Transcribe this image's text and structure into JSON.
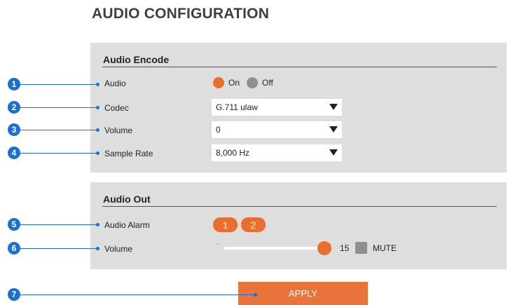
{
  "page": {
    "title": "AUDIO CONFIGURATION"
  },
  "audio_encode": {
    "title": "Audio Encode",
    "audio": {
      "label": "Audio",
      "options": [
        "On",
        "Off"
      ],
      "selected": "On"
    },
    "codec": {
      "label": "Codec",
      "value": "G.711 ulaw"
    },
    "volume": {
      "label": "Volume",
      "value": "0"
    },
    "sample_rate": {
      "label": "Sample Rate",
      "value": "8,000 Hz"
    }
  },
  "audio_out": {
    "title": "Audio Out",
    "alarm": {
      "label": "Audio Alarm",
      "buttons": [
        "1",
        "2"
      ]
    },
    "volume": {
      "label": "Volume",
      "minus": "-",
      "value": "15",
      "mute_label": "MUTE"
    }
  },
  "callouts": [
    "1",
    "2",
    "3",
    "4",
    "5",
    "6",
    "7"
  ],
  "apply": {
    "label": "APPLY"
  },
  "colors": {
    "accent": "#e86f2f",
    "callout": "#1d6fd0",
    "panel": "#dedede"
  }
}
